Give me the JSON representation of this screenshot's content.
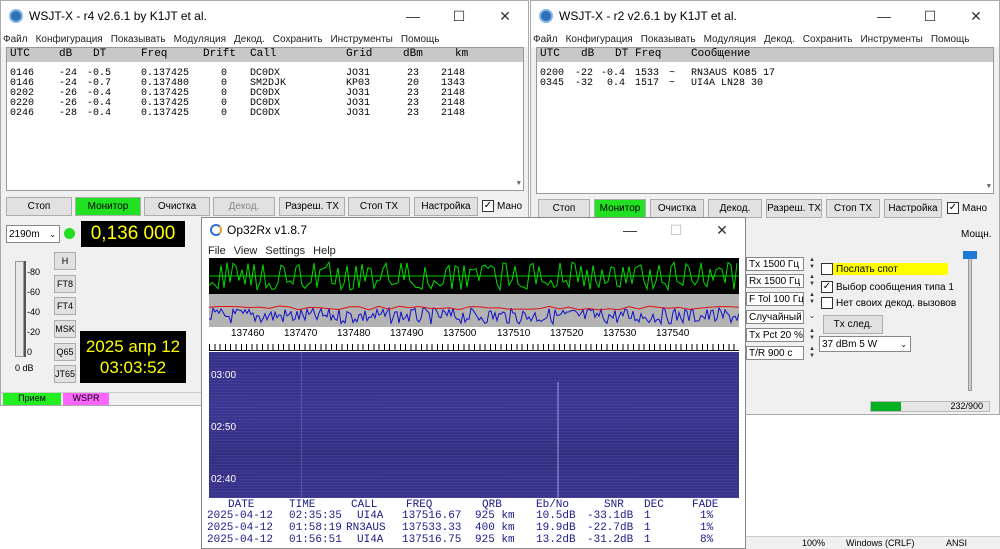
{
  "w1": {
    "title": "WSJT-X - r4   v2.6.1   by K1JT et al.",
    "menu": [
      "Файл",
      "Конфигурация",
      "Показывать",
      "Модуляция",
      "Декод.",
      "Сохранить",
      "Инструменты",
      "Помощь"
    ],
    "headers": [
      "UTC",
      "dB",
      "DT",
      "Freq",
      "Drift",
      "Call",
      "Grid",
      "dBm",
      "km"
    ],
    "rows": [
      [
        "0146",
        "-24",
        "-0.5",
        "0.137425",
        "0",
        "DC0DX",
        "JO31",
        "23",
        "2148"
      ],
      [
        "0146",
        "-24",
        "-0.7",
        "0.137480",
        "0",
        "SM2DJK",
        "KP03",
        "20",
        "1343"
      ],
      [
        "0202",
        "-26",
        "-0.4",
        "0.137425",
        "0",
        "DC0DX",
        "JO31",
        "23",
        "2148"
      ],
      [
        "0220",
        "-26",
        "-0.4",
        "0.137425",
        "0",
        "DC0DX",
        "JO31",
        "23",
        "2148"
      ],
      [
        "0246",
        "-28",
        "-0.4",
        "0.137425",
        "0",
        "DC0DX",
        "JO31",
        "23",
        "2148"
      ]
    ],
    "buttons": [
      "Стоп",
      "Монитор",
      "Очистка",
      "Декод.",
      "Разреш. TX",
      "Стоп TX",
      "Настройка"
    ],
    "mano": "Мано",
    "band": "2190m",
    "freq": "0,136 000",
    "side": [
      "H",
      "FT8",
      "FT4",
      "MSK",
      "Q65",
      "JT65"
    ],
    "scale": [
      "-80",
      "-60",
      "-40",
      "-20",
      "0"
    ],
    "scale_unit": "0 dB",
    "date": "2025 апр 12",
    "time": "03:03:52",
    "status": [
      "Прием",
      "WSPR"
    ]
  },
  "w2": {
    "title": "WSJT-X - r2   v2.6.1   by K1JT et al.",
    "menu": [
      "Файл",
      "Конфигурация",
      "Показывать",
      "Модуляция",
      "Декод.",
      "Сохранить",
      "Инструменты",
      "Помощь"
    ],
    "headers": [
      "UTC",
      "dB",
      "DT",
      "Freq",
      "Сообщение"
    ],
    "rows": [
      [
        "0200",
        "-22",
        "-0.4",
        "1533",
        "~",
        "RN3AUS KO85 17"
      ],
      [
        "0345",
        "-32",
        "0.4",
        "1517",
        "~",
        "UI4A LN28 30"
      ]
    ],
    "buttons": [
      "Стоп",
      "Монитор",
      "Очистка",
      "Декод.",
      "Разреш. TX",
      "Стоп TX",
      "Настройка"
    ],
    "mano": "Мано",
    "tx": "Tx  1500  Гц",
    "rx": "Rx  1500  Гц",
    "ftol": "F Tol  100  Гц",
    "mode": "Случайный",
    "txpct": "Tx Pct  20  %",
    "tr": "T/R  900 с",
    "chk_spot": "Послать спот",
    "chk_type1": "Выбор сообщения типа 1",
    "chk_nodec": "Нет своих декод. вызовов",
    "txnext": "Tx след.",
    "power": "37 dBm  5 W",
    "power_label": "Мощн.",
    "progress": "232/900"
  },
  "op": {
    "title": "Op32Rx v1.8.7",
    "menu": [
      "File",
      "View",
      "Settings",
      "Help"
    ],
    "axis": [
      "137460",
      "137470",
      "137480",
      "137490",
      "137500",
      "137510",
      "137520",
      "137530",
      "137540"
    ],
    "times": [
      "03:00",
      "02:50",
      "02:40"
    ],
    "headers": [
      "DATE",
      "TIME",
      "CALL",
      "FREQ",
      "QRB",
      "Eb/No",
      "SNR",
      "DEC",
      "FADE"
    ],
    "rows": [
      [
        "2025-04-12",
        "02:35:35",
        "UI4A",
        "137516.67",
        "925 km",
        "10.5dB",
        "-33.1dB",
        "1",
        "1%"
      ],
      [
        "2025-04-12",
        "01:58:19",
        "RN3AUS",
        "137533.33",
        "400 km",
        "19.9dB",
        "-22.7dB",
        "1",
        "1%"
      ],
      [
        "2025-04-12",
        "01:56:51",
        "UI4A",
        "137516.75",
        "925 km",
        "13.2dB",
        "-31.2dB",
        "1",
        "8%"
      ]
    ]
  },
  "taskbar": {
    "zoom": "100%",
    "eol": "Windows (CRLF)",
    "enc": "ANSI"
  }
}
